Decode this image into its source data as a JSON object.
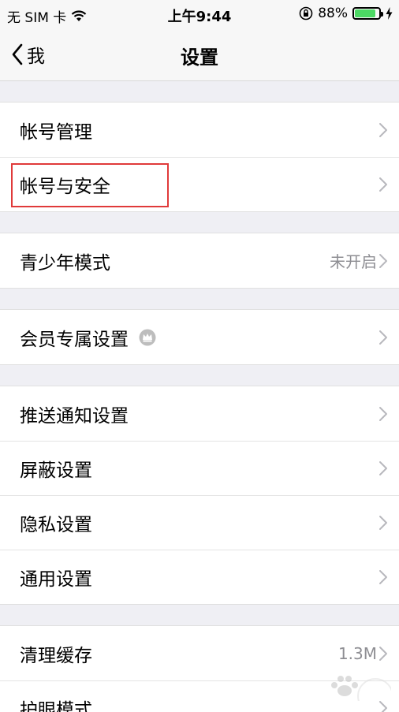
{
  "status_bar": {
    "carrier": "无 SIM 卡",
    "time": "上午9:44",
    "battery_percent": "88%",
    "battery_level": 0.88,
    "battery_color": "#4cd964"
  },
  "nav": {
    "back_label": "我",
    "title": "设置"
  },
  "groups": [
    {
      "items": [
        {
          "label": "帐号管理",
          "value": ""
        },
        {
          "label": "帐号与安全",
          "value": "",
          "highlighted": true
        }
      ]
    },
    {
      "items": [
        {
          "label": "青少年模式",
          "value": "未开启"
        }
      ]
    },
    {
      "items": [
        {
          "label": "会员专属设置",
          "value": "",
          "icon": "crown-icon"
        }
      ]
    },
    {
      "items": [
        {
          "label": "推送通知设置",
          "value": ""
        },
        {
          "label": "屏蔽设置",
          "value": ""
        },
        {
          "label": "隐私设置",
          "value": ""
        },
        {
          "label": "通用设置",
          "value": ""
        }
      ]
    },
    {
      "items": [
        {
          "label": "清理缓存",
          "value": "1.3M"
        },
        {
          "label": "护眼模式",
          "value": ""
        }
      ]
    }
  ],
  "highlight_color": "#e03a3a"
}
